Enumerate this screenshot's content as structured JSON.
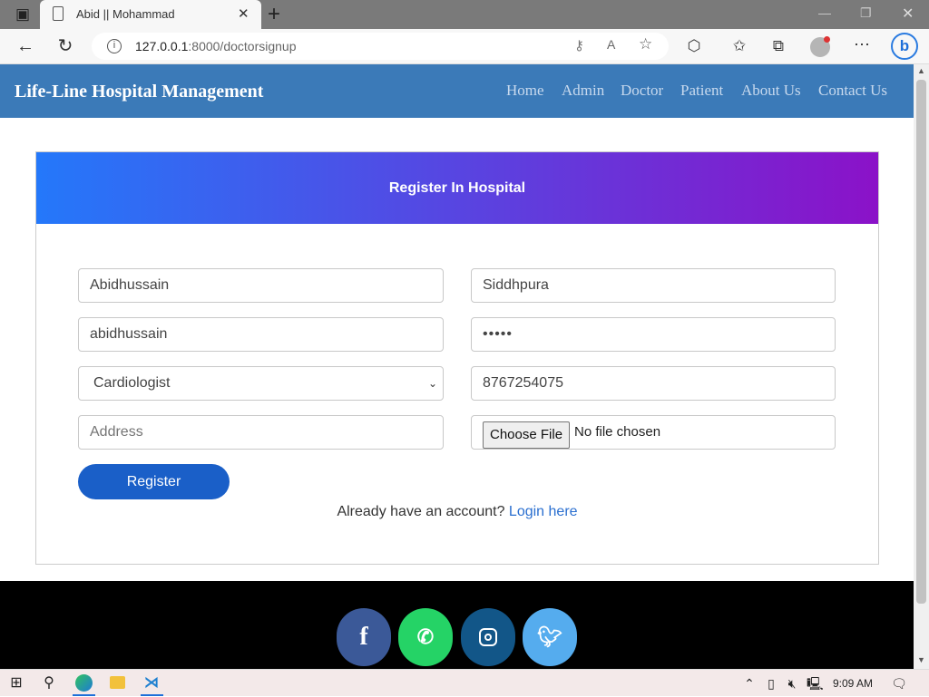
{
  "browser": {
    "tab_title": "Abid || Mohammad",
    "url_host": "127.0.0.1",
    "url_rest": ":8000/doctorsignup"
  },
  "navbar": {
    "brand": "Life-Line Hospital Management",
    "links": [
      "Home",
      "Admin",
      "Doctor",
      "Patient",
      "About Us",
      "Contact Us"
    ]
  },
  "form": {
    "title": "Register In Hospital",
    "first_name": "Abidhussain",
    "last_name": "Siddhpura",
    "username": "abidhussain",
    "password_mask": "•••••",
    "department": "Cardiologist",
    "mobile": "8767254075",
    "address_placeholder": "Address",
    "file_button": "Choose File",
    "file_status": "No file chosen",
    "register_label": "Register",
    "login_prompt": "Already have an account?",
    "login_link": "Login here"
  },
  "footer": {
    "social": [
      "facebook-icon",
      "whatsapp-icon",
      "instagram-icon",
      "twitter-icon"
    ],
    "colors": [
      "#3b5998",
      "#25d366",
      "#125688",
      "#55acee"
    ]
  },
  "taskbar": {
    "time": "9:09 AM"
  },
  "colors": {
    "navbar": "#3b7ab8",
    "button": "#1a5fc8",
    "gradient_start": "#2478fa",
    "gradient_end": "#8b12c8",
    "link": "#2a6fd0"
  }
}
